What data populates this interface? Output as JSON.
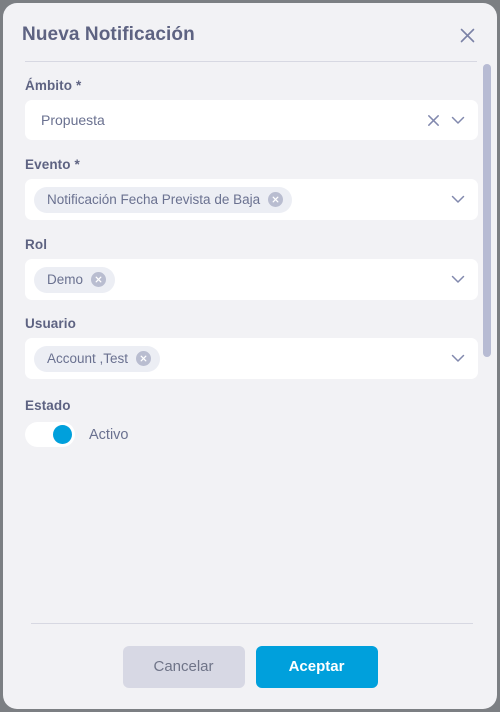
{
  "dialog": {
    "title": "Nueva Notificación",
    "close_icon": "close-icon"
  },
  "fields": [
    {
      "label": "Ámbito *",
      "value": "Propuesta",
      "type": "select-single",
      "clear_icon": "clear-icon",
      "chevron_icon": "chevron-down-icon"
    },
    {
      "label": "Evento *",
      "chip": "Notificación Fecha Prevista de Baja",
      "type": "select-multi",
      "chip_remove_icon": "chip-remove-icon",
      "chevron_icon": "chevron-down-icon"
    },
    {
      "label": "Rol",
      "chip": "Demo",
      "type": "select-multi",
      "chip_remove_icon": "chip-remove-icon",
      "chevron_icon": "chevron-down-icon"
    },
    {
      "label": "Usuario",
      "chip": "Account ,Test",
      "type": "select-multi",
      "chip_remove_icon": "chip-remove-icon",
      "chevron_icon": "chevron-down-icon"
    }
  ],
  "estado": {
    "label": "Estado",
    "toggle_label": "Activo",
    "toggle_on": true
  },
  "footer": {
    "cancel_label": "Cancelar",
    "accept_label": "Aceptar"
  },
  "colors": {
    "accent": "#00a0dc",
    "dialog_bg": "#f2f2f5",
    "label_text": "#5e6382",
    "value_text": "#6a7190",
    "cancel_bg": "#d7d8e4",
    "chip_bg": "#eceef4",
    "divider": "#d7d8e2",
    "scrollbar": "#b7bbd3"
  }
}
